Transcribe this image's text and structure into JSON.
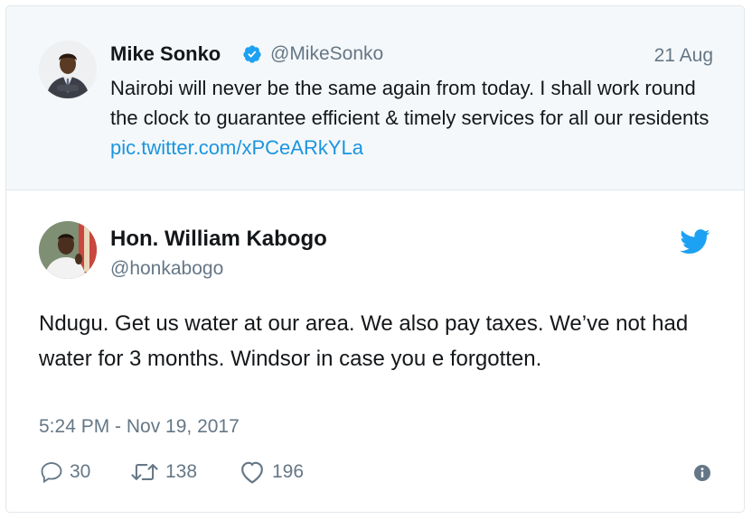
{
  "quoted_tweet": {
    "name": "Mike Sonko",
    "handle": "@MikeSonko",
    "date": "21 Aug",
    "text": "Nairobi will never be the same again from today. I shall work round the clock to guarantee efficient & timely services for all our residents ",
    "link": "pic.twitter.com/xPCeARkYLa"
  },
  "main_tweet": {
    "name": "Hon. William Kabogo",
    "handle": "@honkabogo",
    "text": "Ndugu. Get us water at our area. We also pay taxes. We’ve not had water for 3 months. Windsor in case you e forgotten.",
    "timestamp": "5:24 PM - Nov 19, 2017"
  },
  "actions": {
    "replies": "30",
    "retweets": "138",
    "likes": "196"
  },
  "icons": {
    "verified": "verified-badge-icon",
    "twitter": "twitter-bird-icon",
    "reply": "reply-icon",
    "retweet": "retweet-icon",
    "like": "heart-icon",
    "info": "info-icon"
  },
  "colors": {
    "link": "#1b95e0",
    "secondary_text": "#657786",
    "quoted_bg": "#f5f8fa",
    "border": "#e1e8ed"
  }
}
